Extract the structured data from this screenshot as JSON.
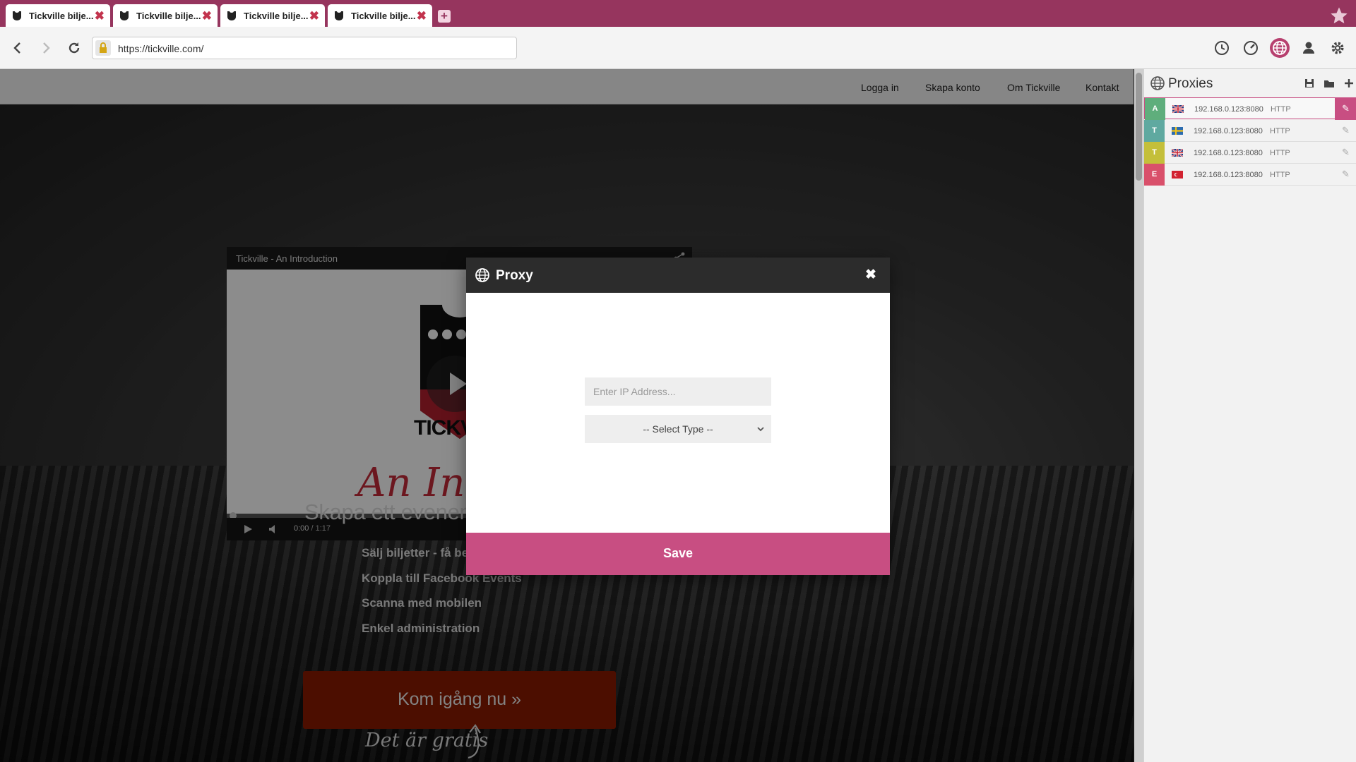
{
  "browser": {
    "tabs": [
      {
        "label": "Tickville bilje..."
      },
      {
        "label": "Tickville bilje..."
      },
      {
        "label": "Tickville bilje..."
      },
      {
        "label": "Tickville bilje..."
      }
    ],
    "tab_close": "✖",
    "new_tab": "+",
    "url": "https://tickville.com/",
    "accent_color": "#96355e",
    "icons": [
      "back-icon",
      "forward-icon",
      "reload-icon",
      "lock-icon",
      "history-icon",
      "speed-icon",
      "globe-icon",
      "user-icon",
      "gear-icon",
      "star-icon"
    ]
  },
  "site": {
    "nav": [
      "Logga in",
      "Skapa konto",
      "Om Tickville",
      "Kontakt"
    ],
    "video": {
      "title": "Tickville - An Introduction",
      "brand": "TICKV",
      "script_text": "An Intro",
      "time_current": "0:00",
      "time_total": "/ 1:17"
    },
    "heading": "Skapa ett evenema",
    "features": [
      "Sälj biljetter - få bet",
      "Koppla till Facebook Events",
      "Scanna med mobilen",
      "Enkel administration"
    ],
    "cta_label": "Kom igång nu »",
    "cta_sub": "Det är gratis"
  },
  "proxies_panel": {
    "title": "Proxies",
    "rows": [
      {
        "letter": "A",
        "color": "#5fae7c",
        "flag": "gb",
        "ip": "192.168.0.123:8080",
        "type": "HTTP",
        "selected": true
      },
      {
        "letter": "T",
        "color": "#5fa9a0",
        "flag": "se",
        "ip": "192.168.0.123:8080",
        "type": "HTTP",
        "selected": false
      },
      {
        "letter": "T",
        "color": "#c4bf3a",
        "flag": "gb",
        "ip": "192.168.0.123:8080",
        "type": "HTTP",
        "selected": false
      },
      {
        "letter": "E",
        "color": "#d9506b",
        "flag": "tr",
        "ip": "192.168.0.123:8080",
        "type": "HTTP",
        "selected": false
      }
    ]
  },
  "modal": {
    "title": "Proxy",
    "close": "✖",
    "ip_placeholder": "Enter IP Address...",
    "select_value": "-- Select Type --",
    "save_label": "Save",
    "save_color": "#c84e82"
  }
}
